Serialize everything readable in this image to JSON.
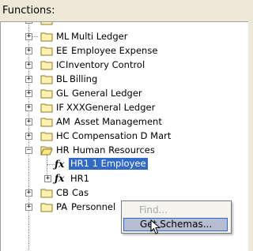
{
  "panel": {
    "label": "Functions:"
  },
  "tree": {
    "items": [
      {
        "code": "ML",
        "name": "Multi Ledger"
      },
      {
        "code": "EE",
        "name": "Employee Expense"
      },
      {
        "code": "IC",
        "name": "Inventory Control"
      },
      {
        "code": "BL",
        "name": "Billing"
      },
      {
        "code": "GL",
        "name": "General Ledger"
      },
      {
        "code": "IF",
        "name": "XXXGeneral Ledger"
      },
      {
        "code": "AM",
        "name": "Asset Management"
      },
      {
        "code": "HC",
        "name": "Compensation D Mart"
      },
      {
        "code": "HR",
        "name": "Human Resources"
      },
      {
        "code": "CB",
        "name": "Cas"
      },
      {
        "code": "PA",
        "name": "Personnel"
      }
    ],
    "children": [
      {
        "name": "HR1 1  Employee",
        "selected": true
      },
      {
        "name": "HR1"
      }
    ]
  },
  "context_menu": {
    "items": [
      {
        "label": "Find...",
        "enabled": false
      },
      {
        "label": "Get Schemas...",
        "enabled": true
      }
    ]
  }
}
